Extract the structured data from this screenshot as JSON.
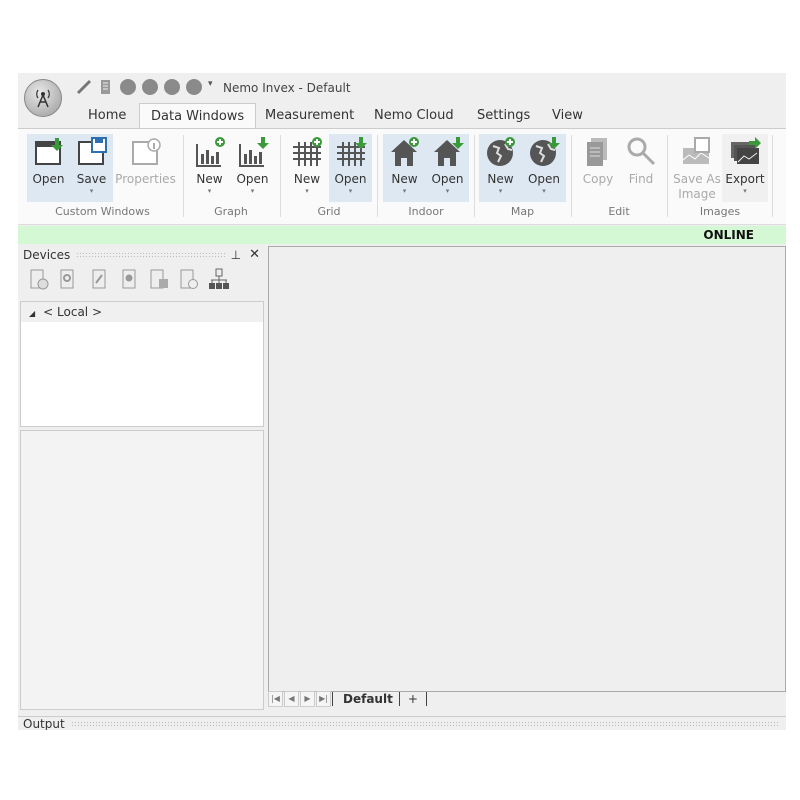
{
  "window": {
    "title": "Nemo Invex - Default"
  },
  "quick_access": [
    "connect-icon",
    "log-icon",
    "record-icon",
    "play-icon",
    "pause-icon",
    "stop-icon",
    "customize-dropdown-icon"
  ],
  "tabs": [
    {
      "label": "Home"
    },
    {
      "label": "Data Windows",
      "active": true
    },
    {
      "label": "Measurement"
    },
    {
      "label": "Nemo Cloud"
    },
    {
      "label": "Settings"
    },
    {
      "label": "View"
    }
  ],
  "ribbon": {
    "custom_windows": {
      "label": "Custom Windows",
      "open": "Open",
      "save": "Save",
      "properties": "Properties"
    },
    "graph": {
      "label": "Graph",
      "new": "New",
      "open": "Open"
    },
    "grid": {
      "label": "Grid",
      "new": "New",
      "open": "Open"
    },
    "indoor": {
      "label": "Indoor",
      "new": "New",
      "open": "Open"
    },
    "map": {
      "label": "Map",
      "new": "New",
      "open": "Open"
    },
    "edit": {
      "label": "Edit",
      "copy": "Copy",
      "find": "Find"
    },
    "images": {
      "label": "Images",
      "save_as_image_1": "Save As",
      "save_as_image_2": "Image",
      "export": "Export"
    }
  },
  "status": {
    "text": "ONLINE",
    "color": "#d4f7d4"
  },
  "devices": {
    "title": "Devices",
    "tree": [
      {
        "label": "< Local >",
        "expanded": true
      }
    ]
  },
  "sheets": {
    "tabs": [
      "Default"
    ],
    "add": "+"
  },
  "output": {
    "title": "Output"
  },
  "colors": {
    "accent_green": "#3a9a3a",
    "highlight": "#dde8f2"
  }
}
